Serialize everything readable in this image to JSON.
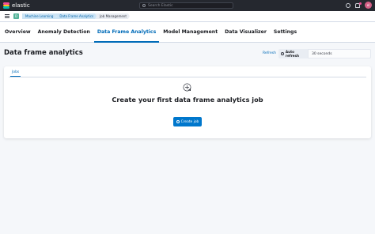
{
  "header": {
    "brand": "elastic",
    "search_placeholder": "Search Elastic",
    "avatar_initials": "el"
  },
  "breadcrumbs": [
    "Machine Learning",
    "Data Frame Analytics",
    "Job Management"
  ],
  "tabs": [
    "Overview",
    "Anomaly Detection",
    "Data Frame Analytics",
    "Model Management",
    "Data Visualizer",
    "Settings"
  ],
  "active_tab": "Data Frame Analytics",
  "page": {
    "title": "Data frame analytics",
    "refresh_label": "Refresh",
    "auto_refresh_label": "Auto refresh",
    "refresh_interval": "30 seconds"
  },
  "panel": {
    "tab_label": "Jobs",
    "empty_title": "Create your first data frame analytics job",
    "create_button_label": "Create job"
  },
  "colors": {
    "primary": "#0077cc",
    "link": "#006bb8",
    "header_bg": "#25282f"
  },
  "icons": {
    "menu": "hamburger-icon",
    "search": "search-icon",
    "empty": "add-chart-icon",
    "button": "plus-circle-icon"
  }
}
